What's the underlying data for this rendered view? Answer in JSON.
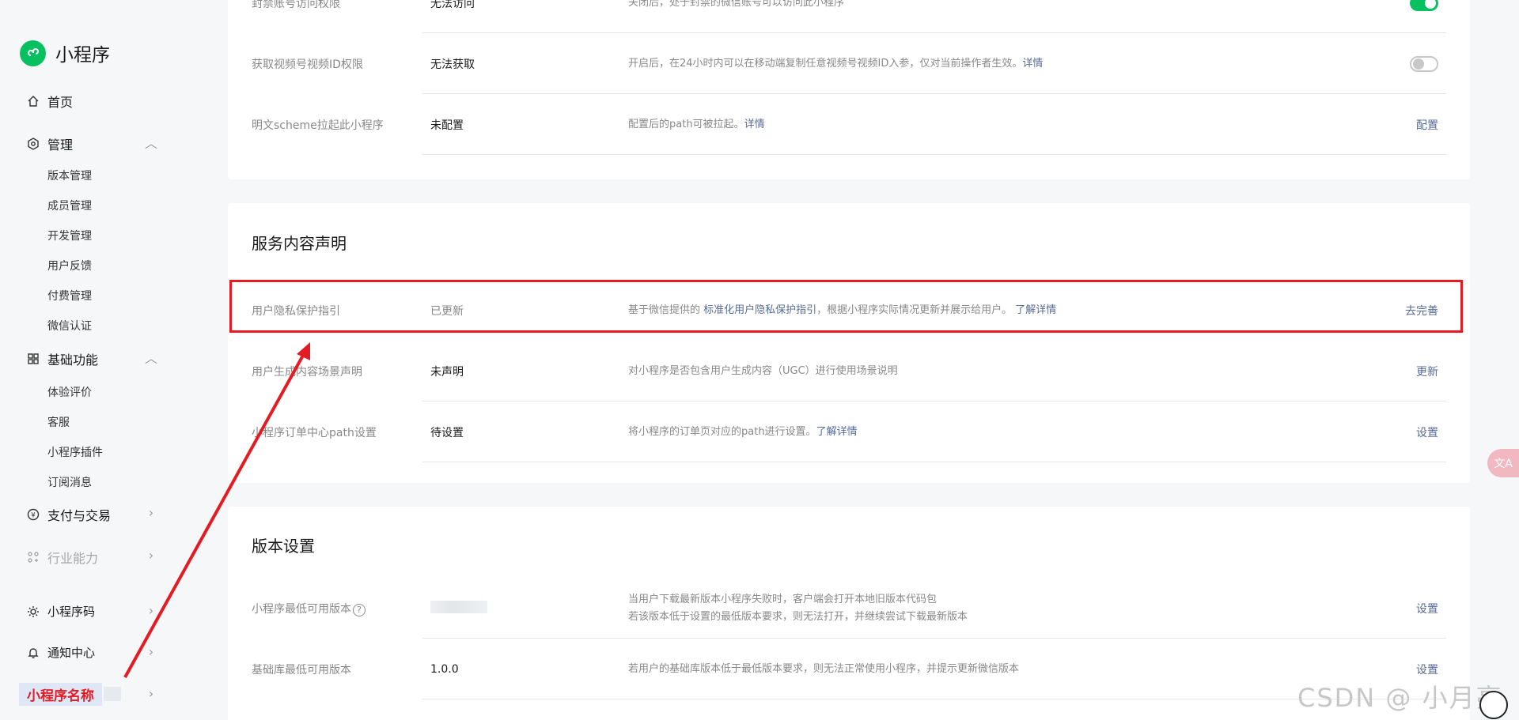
{
  "sidebar": {
    "brand": "小程序",
    "home": "首页",
    "manage": {
      "label": "管理",
      "items": [
        "版本管理",
        "成员管理",
        "开发管理",
        "用户反馈",
        "付费管理",
        "微信认证"
      ]
    },
    "basic": {
      "label": "基础功能",
      "items": [
        "体验评价",
        "客服",
        "小程序插件",
        "订阅消息"
      ]
    },
    "payment": "支付与交易",
    "industry": "行业能力",
    "qrcode": "小程序码",
    "notify": "通知中心",
    "app_name": "小程序名称"
  },
  "card1": {
    "rows": [
      {
        "label": "封禁账号访问权限",
        "status": "无法访问",
        "desc": "关闭后，处于封禁的微信账号可以访问此小程序",
        "toggle": "on"
      },
      {
        "label": "获取视频号视频ID权限",
        "status": "无法获取",
        "desc": "开启后，在24小时内可以在移动端复制任意视频号视频ID入参，仅对当前操作者生效。",
        "link": "详情",
        "toggle": "off"
      },
      {
        "label": "明文scheme拉起此小程序",
        "status": "未配置",
        "desc": "配置后的path可被拉起。",
        "link": "详情",
        "action": "配置"
      }
    ]
  },
  "card2": {
    "title": "服务内容声明",
    "rows": [
      {
        "label": "用户隐私保护指引",
        "status": "已更新",
        "desc_pre": "基于微信提供的 ",
        "desc_link": "标准化用户隐私保护指引",
        "desc_post": "，根据小程序实际情况更新并展示给用户。 ",
        "link": "了解详情",
        "action": "去完善"
      },
      {
        "label": "用户生成内容场景声明",
        "status": "未声明",
        "desc": "对小程序是否包含用户生成内容（UGC）进行使用场景说明",
        "action": "更新"
      },
      {
        "label": "小程序订单中心path设置",
        "status": "待设置",
        "desc": "将小程序的订单页对应的path进行设置。",
        "link": "了解详情",
        "action": "设置"
      }
    ]
  },
  "card3": {
    "title": "版本设置",
    "rows": [
      {
        "label": "小程序最低可用版本",
        "help": "?",
        "desc_line1": "当用户下载最新版本小程序失败时，客户端会打开本地旧版本代码包",
        "desc_line2": "若该版本低于设置的最低版本要求，则无法打开，并继续尝试下载最新版本",
        "action": "设置"
      },
      {
        "label": "基础库最低可用版本",
        "status": "1.0.0",
        "desc": "若用户的基础库版本低于最低版本要求，则无法正常使用小程序，并提示更新微信版本",
        "action": "设置"
      }
    ]
  },
  "watermark": "CSDN @ 小月亮",
  "colors": {
    "accent": "#07c160",
    "link": "#576b95",
    "annotation": "#e51b23"
  }
}
